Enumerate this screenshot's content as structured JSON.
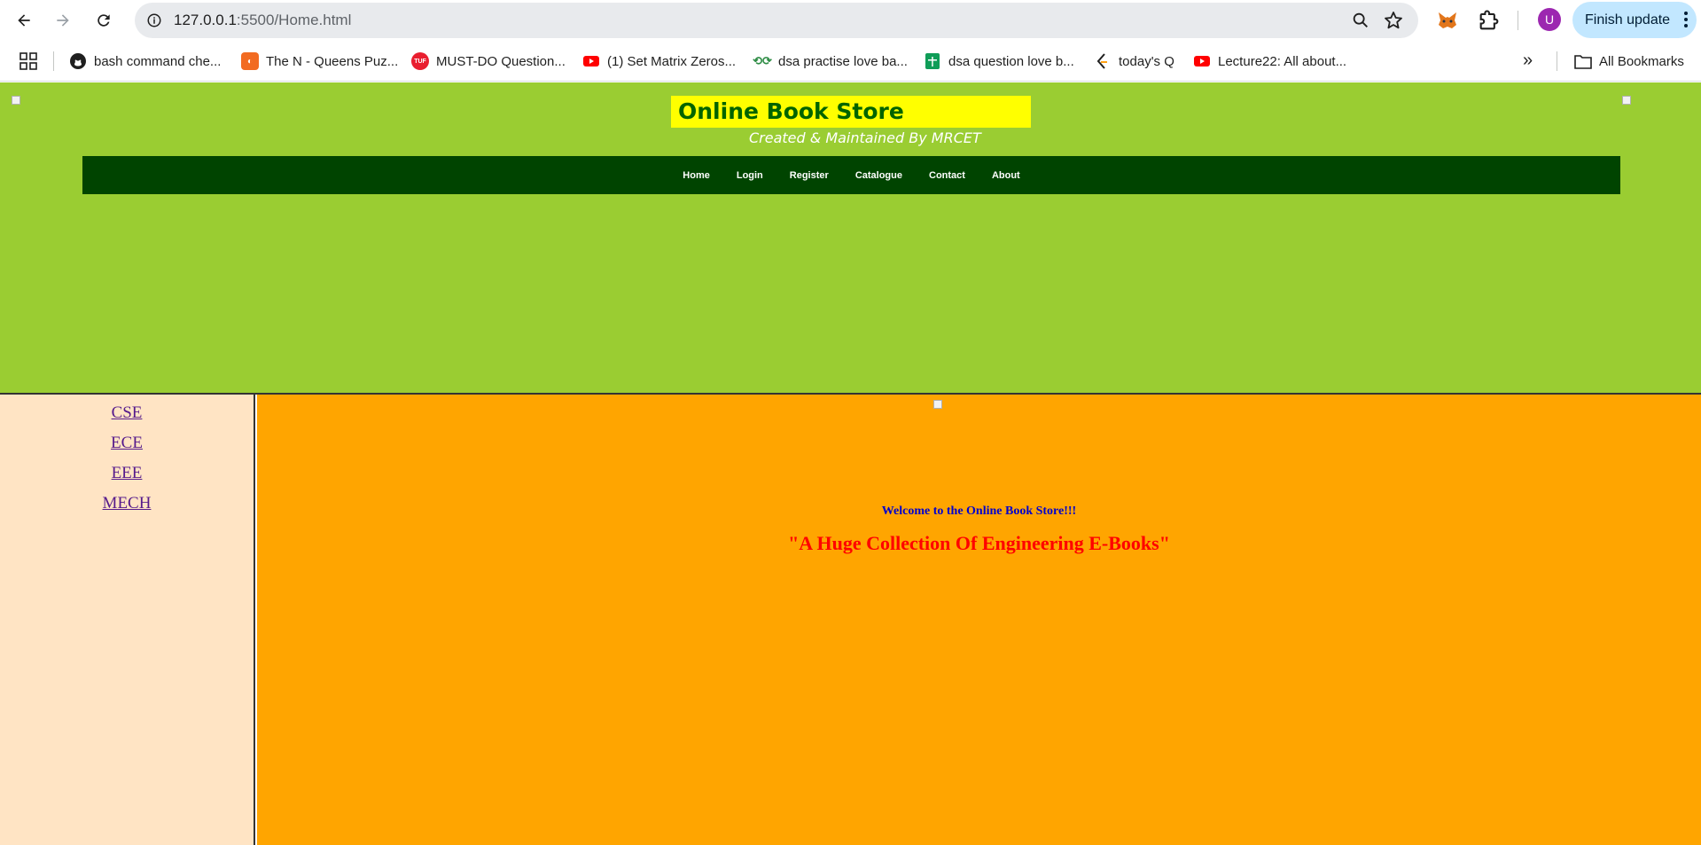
{
  "browser": {
    "url_host": "127.0.0.1",
    "url_path": ":5500/Home.html",
    "profile_initial": "U",
    "finish_update_label": "Finish update",
    "bookmarks": [
      {
        "label": "bash command che...",
        "icon": "github-icon",
        "color": "#1f1f1f"
      },
      {
        "label": "The N - Queens Puz...",
        "icon": "codingninjas-icon",
        "color": "#f26b21"
      },
      {
        "label": "MUST-DO Question...",
        "icon": "tuf-icon",
        "color": "#e91e2f"
      },
      {
        "label": "(1) Set Matrix Zeros...",
        "icon": "youtube-icon",
        "color": "#ff0000"
      },
      {
        "label": "dsa practise love ba...",
        "icon": "geeksforgeeks-icon",
        "color": "#2f8d46"
      },
      {
        "label": "dsa question love b...",
        "icon": "sheets-icon",
        "color": "#0f9d58"
      },
      {
        "label": "today's Q",
        "icon": "leetcode-icon",
        "color": "#ffa116"
      },
      {
        "label": "Lecture22: All about...",
        "icon": "youtube-icon",
        "color": "#ff0000"
      }
    ],
    "all_bookmarks_label": "All Bookmarks"
  },
  "site": {
    "title": "Online Book Store",
    "subtitle": "Created & Maintained By MRCET",
    "nav": [
      "Home",
      "Login",
      "Register",
      "Catalogue",
      "Contact",
      "About"
    ],
    "sidebar": [
      "CSE",
      "ECE",
      "EEE",
      "MECH"
    ],
    "welcome": "Welcome to the Online Book Store!!!",
    "tagline": "\"A Huge Collection Of Engineering E-Books\""
  },
  "colors": {
    "header_bg": "#9acd32",
    "nav_bg": "#004400",
    "title_bg": "#ffff00",
    "title_text": "#006400",
    "sidebar_bg": "#ffe4c4",
    "main_bg": "#ffa500",
    "welcome_text": "#0000cd",
    "tagline_text": "#ff0000"
  }
}
